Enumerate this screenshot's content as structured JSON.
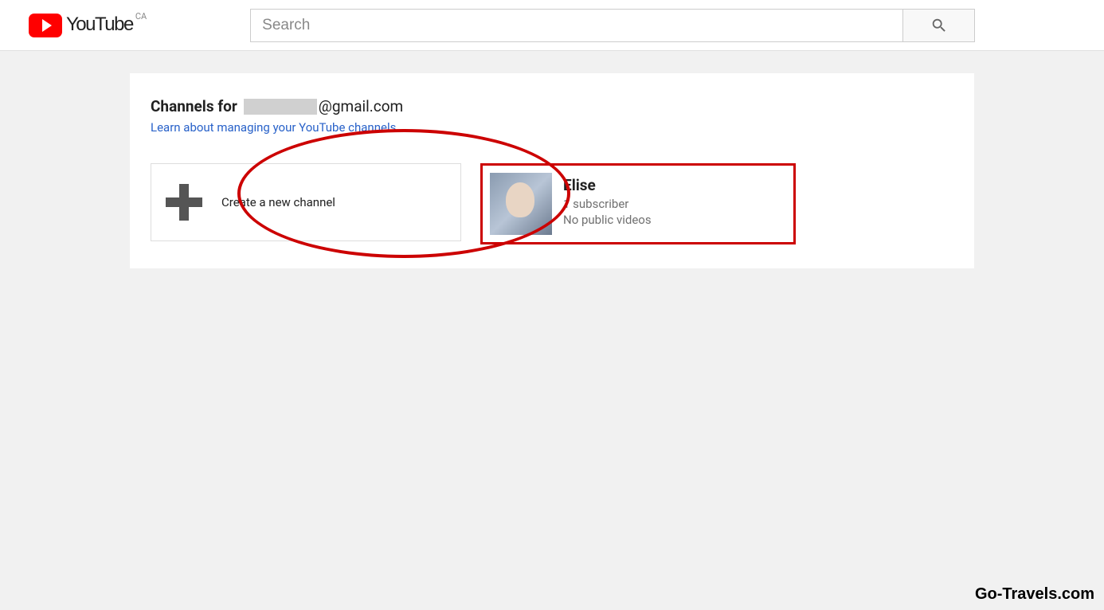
{
  "header": {
    "logo_text": "YouTube",
    "region": "CA",
    "search_placeholder": "Search"
  },
  "main": {
    "title_prefix": "Channels for",
    "title_suffix": "@gmail.com",
    "learn_link": "Learn about managing your YouTube channels",
    "create_channel_label": "Create a new channel",
    "channel": {
      "name": "Elise",
      "subscribers": "1 subscriber",
      "videos": "No public videos"
    }
  },
  "watermark": "Go-Travels.com"
}
